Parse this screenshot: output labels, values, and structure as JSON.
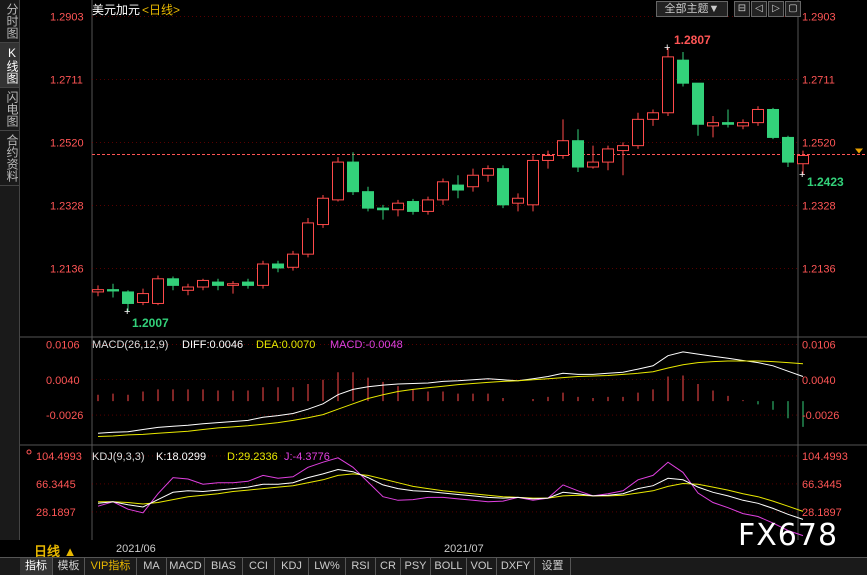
{
  "left_tabs": [
    "分时图",
    "K线图",
    "闪电图",
    "合约资料"
  ],
  "active_left_tab": 1,
  "header": {
    "symbol": "美元加元",
    "period_tag": "<日线>",
    "main_selector": "全部主题▼"
  },
  "window_buttons": [
    "⊟",
    "◁",
    "▷",
    "▢"
  ],
  "chart_data": {
    "type": "candlestick",
    "price_ticks": [
      "1.2903",
      "1.2711",
      "1.2520",
      "1.2328",
      "1.2136"
    ],
    "price_range": [
      1.1931,
      1.2953
    ],
    "last_price": 1.2483,
    "high_label": "1.2807",
    "low_label": "1.2007",
    "last_label": "1.2423",
    "candles": [
      [
        1.2065,
        1.2085,
        1.2052,
        1.2072
      ],
      [
        1.2072,
        1.209,
        1.2048,
        1.2068
      ],
      [
        1.2065,
        1.207,
        1.2007,
        1.203
      ],
      [
        1.2033,
        1.2075,
        1.2025,
        1.206
      ],
      [
        1.203,
        1.2115,
        1.2025,
        1.2105
      ],
      [
        1.2105,
        1.2112,
        1.207,
        1.2085
      ],
      [
        1.207,
        1.209,
        1.2055,
        1.208
      ],
      [
        1.208,
        1.2105,
        1.207,
        1.21
      ],
      [
        1.2095,
        1.2105,
        1.207,
        1.2085
      ],
      [
        1.2085,
        1.2098,
        1.206,
        1.209
      ],
      [
        1.2095,
        1.2105,
        1.2075,
        1.2085
      ],
      [
        1.2085,
        1.216,
        1.2075,
        1.215
      ],
      [
        1.215,
        1.216,
        1.2125,
        1.2138
      ],
      [
        1.214,
        1.219,
        1.213,
        1.218
      ],
      [
        1.218,
        1.229,
        1.217,
        1.2275
      ],
      [
        1.227,
        1.236,
        1.226,
        1.235
      ],
      [
        1.2345,
        1.2475,
        1.234,
        1.246
      ],
      [
        1.246,
        1.249,
        1.236,
        1.237
      ],
      [
        1.237,
        1.2385,
        1.231,
        1.232
      ],
      [
        1.232,
        1.233,
        1.2285,
        1.2315
      ],
      [
        1.2315,
        1.2345,
        1.2295,
        1.2335
      ],
      [
        1.234,
        1.2348,
        1.23,
        1.231
      ],
      [
        1.231,
        1.2355,
        1.23,
        1.2345
      ],
      [
        1.2345,
        1.241,
        1.233,
        1.24
      ],
      [
        1.239,
        1.242,
        1.235,
        1.2375
      ],
      [
        1.2385,
        1.244,
        1.237,
        1.242
      ],
      [
        1.242,
        1.245,
        1.24,
        1.244
      ],
      [
        1.244,
        1.245,
        1.232,
        1.233
      ],
      [
        1.2335,
        1.2365,
        1.231,
        1.235
      ],
      [
        1.233,
        1.248,
        1.231,
        1.2465
      ],
      [
        1.2465,
        1.2495,
        1.244,
        1.248
      ],
      [
        1.248,
        1.259,
        1.247,
        1.2525
      ],
      [
        1.2525,
        1.256,
        1.243,
        1.2445
      ],
      [
        1.2445,
        1.251,
        1.244,
        1.246
      ],
      [
        1.246,
        1.251,
        1.2435,
        1.25
      ],
      [
        1.2495,
        1.252,
        1.242,
        1.251
      ],
      [
        1.251,
        1.261,
        1.25,
        1.259
      ],
      [
        1.259,
        1.262,
        1.257,
        1.261
      ],
      [
        1.261,
        1.2807,
        1.26,
        1.278
      ],
      [
        1.277,
        1.2795,
        1.269,
        1.27
      ],
      [
        1.27,
        1.27,
        1.254,
        1.2575
      ],
      [
        1.257,
        1.26,
        1.2535,
        1.258
      ],
      [
        1.258,
        1.262,
        1.2565,
        1.2575
      ],
      [
        1.257,
        1.259,
        1.256,
        1.258
      ],
      [
        1.258,
        1.263,
        1.257,
        1.262
      ],
      [
        1.262,
        1.2625,
        1.253,
        1.2535
      ],
      [
        1.2535,
        1.254,
        1.2445,
        1.246
      ],
      [
        1.2455,
        1.2495,
        1.2423,
        1.248
      ]
    ],
    "macd": {
      "label": "MACD(26,12,9)",
      "diff": "DIFF:0.0046",
      "dea": "DEA:0.0070",
      "macd": "MACD:-0.0048",
      "ticks": [
        "0.0106",
        "0.0040",
        "-0.0026"
      ],
      "range": [
        -0.008,
        0.0118
      ],
      "diff_values": [
        -0.006,
        -0.0058,
        -0.0057,
        -0.0053,
        -0.0049,
        -0.0047,
        -0.0045,
        -0.0042,
        -0.004,
        -0.0038,
        -0.0036,
        -0.003,
        -0.0027,
        -0.0023,
        -0.0015,
        -0.0005,
        0.0012,
        0.0022,
        0.0027,
        0.003,
        0.0032,
        0.0033,
        0.0034,
        0.0037,
        0.0038,
        0.004,
        0.0042,
        0.004,
        0.0038,
        0.0042,
        0.0046,
        0.0052,
        0.005,
        0.005,
        0.0052,
        0.0054,
        0.006,
        0.0066,
        0.0085,
        0.0092,
        0.0088,
        0.0084,
        0.008,
        0.0076,
        0.0072,
        0.0066,
        0.0056,
        0.0046
      ],
      "dea_values": [
        -0.0066,
        -0.0065,
        -0.0063,
        -0.0062,
        -0.006,
        -0.0058,
        -0.0056,
        -0.0053,
        -0.005,
        -0.0048,
        -0.0046,
        -0.0043,
        -0.004,
        -0.0036,
        -0.0031,
        -0.0025,
        -0.0015,
        -0.0005,
        0.0005,
        0.0012,
        0.0018,
        0.0022,
        0.0025,
        0.0028,
        0.0031,
        0.0033,
        0.0035,
        0.0037,
        0.0038,
        0.004,
        0.0042,
        0.0044,
        0.0046,
        0.0047,
        0.0048,
        0.005,
        0.0052,
        0.0055,
        0.0062,
        0.0068,
        0.0072,
        0.0074,
        0.0075,
        0.0075,
        0.0075,
        0.0074,
        0.0072,
        0.007
      ],
      "hist_values": [
        0.0012,
        0.0014,
        0.0012,
        0.0018,
        0.0022,
        0.0022,
        0.0022,
        0.0022,
        0.002,
        0.002,
        0.002,
        0.0026,
        0.0026,
        0.0026,
        0.0032,
        0.004,
        0.0054,
        0.0054,
        0.0044,
        0.0036,
        0.0028,
        0.0022,
        0.0018,
        0.0018,
        0.0014,
        0.0014,
        0.0014,
        0.0006,
        0.0,
        0.0004,
        0.0008,
        0.0016,
        0.0008,
        0.0006,
        0.0008,
        0.0008,
        0.0016,
        0.0022,
        0.0046,
        0.0048,
        0.0032,
        0.002,
        0.001,
        0.0002,
        -0.0006,
        -0.0016,
        -0.0032,
        -0.0048
      ]
    },
    "kdj": {
      "label": "KDJ(9,3,3)",
      "k": "K:18.0299",
      "d": "D:29.2336",
      "j": "J:-4.3776",
      "ticks": [
        "104.4993",
        "66.3445",
        "28.1897"
      ],
      "range": [
        -10,
        118
      ],
      "k_values": [
        40,
        42,
        38,
        35,
        45,
        55,
        57,
        56,
        58,
        60,
        62,
        66,
        66,
        68,
        75,
        80,
        86,
        83,
        75,
        65,
        60,
        57,
        56,
        54,
        52,
        50,
        48,
        47,
        48,
        46,
        47,
        55,
        53,
        50,
        51,
        53,
        60,
        64,
        74,
        72,
        62,
        55,
        50,
        44,
        40,
        33,
        25,
        18
      ],
      "d_values": [
        42,
        42,
        41,
        39,
        41,
        45,
        49,
        51,
        53,
        56,
        58,
        60,
        62,
        64,
        68,
        72,
        78,
        80,
        78,
        73,
        68,
        63,
        60,
        57,
        55,
        53,
        51,
        49,
        48,
        47,
        47,
        50,
        51,
        50,
        50,
        51,
        54,
        57,
        63,
        67,
        66,
        62,
        58,
        53,
        49,
        43,
        36,
        29
      ],
      "j_values": [
        36,
        42,
        32,
        27,
        53,
        75,
        73,
        66,
        68,
        68,
        70,
        78,
        74,
        76,
        89,
        96,
        102,
        89,
        69,
        49,
        44,
        45,
        48,
        48,
        46,
        44,
        42,
        43,
        48,
        44,
        47,
        65,
        57,
        50,
        53,
        57,
        72,
        78,
        96,
        82,
        54,
        41,
        34,
        26,
        22,
        13,
        3,
        -4
      ]
    },
    "x_labels": [
      "2021/06",
      "2021/07"
    ]
  },
  "period_button": "日线 ▲",
  "bottom_tabs": [
    "指标",
    "模板",
    "VIP指标",
    "MA",
    "MACD",
    "BIAS",
    "CCI",
    "KDJ",
    "LW%",
    "RSI",
    "CR",
    "PSY",
    "BOLL",
    "VOL",
    "DXFY",
    "设置"
  ],
  "active_bottom_tab": 0,
  "watermark": "FX678",
  "colors": {
    "up": "#ff4a4a",
    "down": "#33d17a",
    "grid": "#8b0000",
    "axis_text": "#ff5555",
    "diff": "#ffffff",
    "dea": "#e8e800",
    "macd_text": "#e040e0",
    "kdj_j": "#e040e0"
  }
}
